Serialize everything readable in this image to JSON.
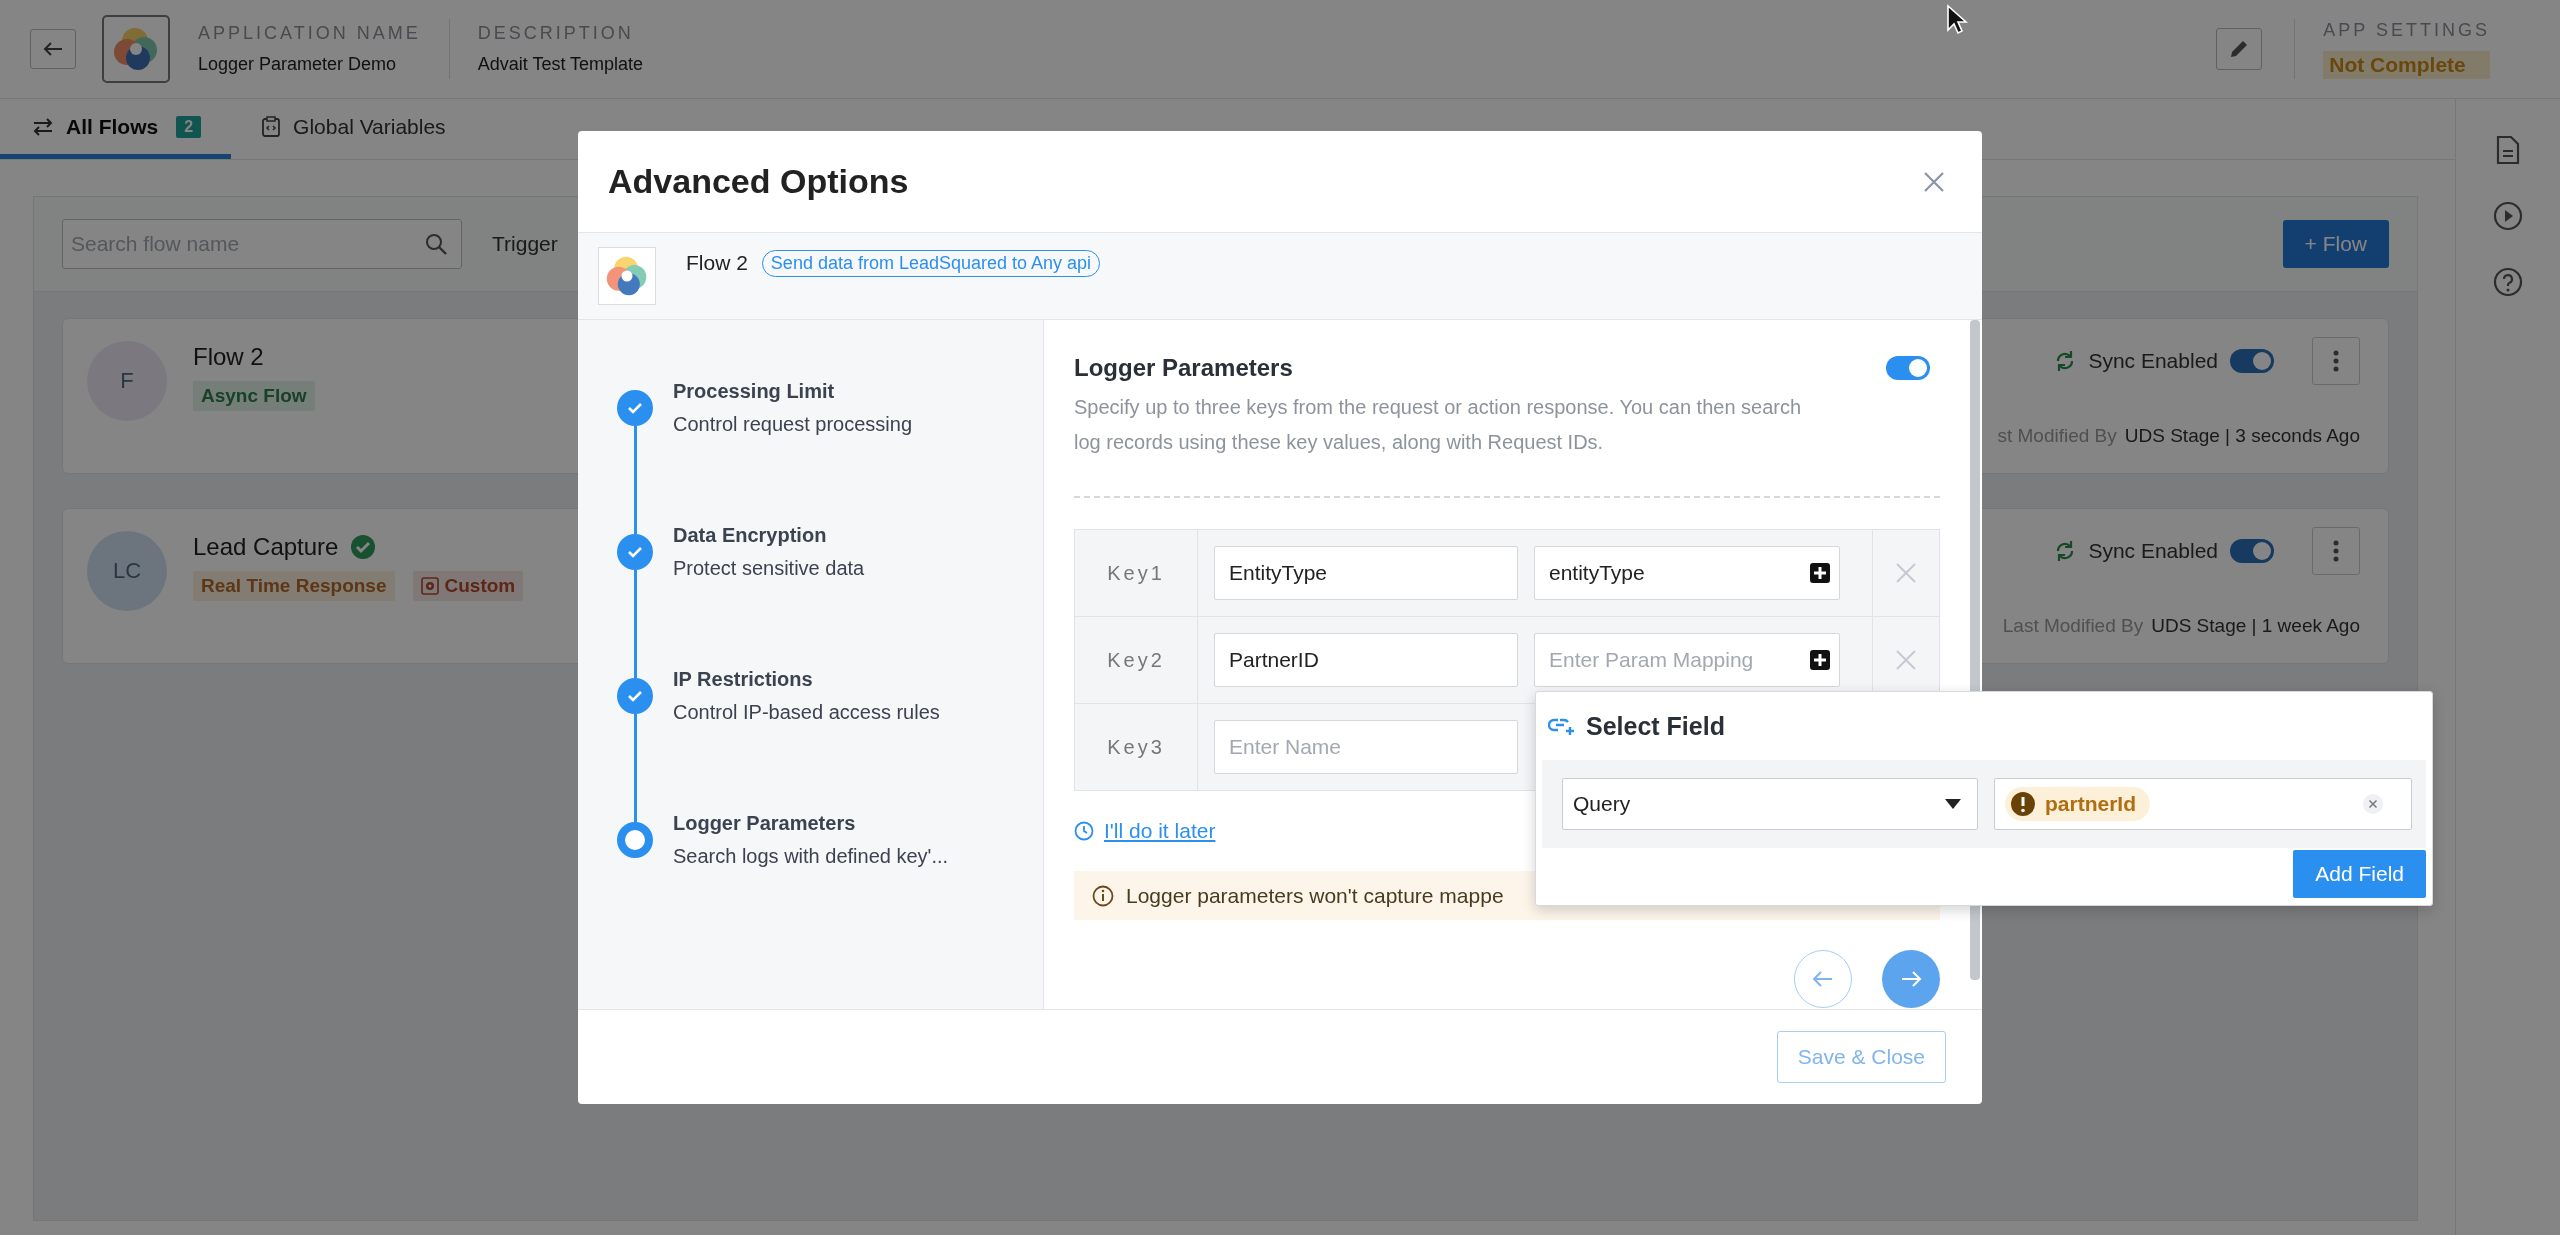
{
  "header": {
    "app_name_label": "APPLICATION NAME",
    "app_name": "Logger Parameter Demo",
    "description_label": "DESCRIPTION",
    "description": "Advait Test Template",
    "settings_label": "APP SETTINGS",
    "settings_status": "Not Complete"
  },
  "tabs": [
    {
      "label": "All Flows",
      "count": "2",
      "selected": true
    },
    {
      "label": "Global Variables",
      "selected": false
    }
  ],
  "toolbar": {
    "search": {
      "placeholder": "Search flow name"
    },
    "trigger_label": "Trigger",
    "add_button": "+ Flow"
  },
  "flows": [
    {
      "avatar": {
        "initials": "F",
        "kind": "lavender"
      },
      "name": "Flow 2",
      "verified": false,
      "tags": [
        {
          "label": "Async Flow",
          "kind": "success"
        }
      ],
      "sync_label": "Sync Enabled",
      "sync_on": true,
      "modified_label": "st Modified By",
      "modified_value": "UDS Stage | 3 seconds Ago"
    },
    {
      "avatar": {
        "initials": "LC",
        "kind": "sky"
      },
      "name": "Lead Capture",
      "verified": true,
      "tags": [
        {
          "label": "Real Time Response",
          "kind": "warning"
        },
        {
          "label": "Custom",
          "kind": "custom"
        }
      ],
      "sync_label": "Sync Enabled",
      "sync_on": true,
      "modified_label": "Last Modified By",
      "modified_value": "UDS Stage | 1 week Ago"
    }
  ],
  "modal": {
    "title": "Advanced Options",
    "flow_name": "Flow 2",
    "flow_tag": "Send data from LeadSquared to Any api",
    "steps": [
      {
        "title": "Processing Limit",
        "subtitle": "Control request processing",
        "completed": true
      },
      {
        "title": "Data Encryption",
        "subtitle": "Protect sensitive data",
        "completed": true
      },
      {
        "title": "IP Restrictions",
        "subtitle": "Control IP-based access rules",
        "completed": true
      },
      {
        "title": "Logger Parameters",
        "subtitle": "Search logs with defined key'...",
        "completed": false
      }
    ],
    "section": {
      "title": "Logger Parameters",
      "enabled": true,
      "description": "Specify up to three keys from the request or action response. You can then search log records using these key values, along with Request IDs.",
      "keys": [
        {
          "label": "Key1",
          "name": "EntityType",
          "mapping": "entityType"
        },
        {
          "label": "Key2",
          "name": "PartnerID",
          "mapping_placeholder": "Enter Param Mapping"
        },
        {
          "label": "Key3",
          "name_placeholder": "Enter Name"
        }
      ],
      "later_link": "I'll do it later",
      "notice": "Logger parameters won't capture mappe"
    },
    "save_button": "Save & Close"
  },
  "popup": {
    "title": "Select Field",
    "source": "Query",
    "chip": "partnerId",
    "add_button": "Add Field"
  }
}
